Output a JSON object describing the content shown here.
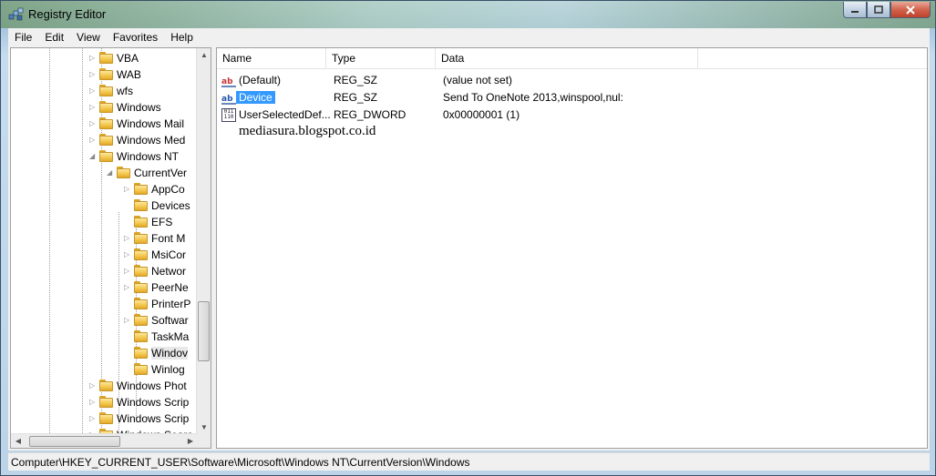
{
  "window": {
    "title": "Registry Editor"
  },
  "menu": [
    "File",
    "Edit",
    "View",
    "Favorites",
    "Help"
  ],
  "tree": {
    "items": [
      {
        "label": "VBA",
        "expander": "collapsed"
      },
      {
        "label": "WAB",
        "expander": "collapsed"
      },
      {
        "label": "wfs",
        "expander": "collapsed"
      },
      {
        "label": "Windows",
        "expander": "collapsed"
      },
      {
        "label": "Windows Mail",
        "expander": "collapsed"
      },
      {
        "label": "Windows Med",
        "expander": "collapsed"
      },
      {
        "label": "Windows NT",
        "expander": "expanded"
      },
      {
        "label": "CurrentVer",
        "expander": "expanded"
      },
      {
        "label": "AppCo",
        "expander": "collapsed"
      },
      {
        "label": "Devices",
        "expander": "none"
      },
      {
        "label": "EFS",
        "expander": "none"
      },
      {
        "label": "Font M",
        "expander": "collapsed"
      },
      {
        "label": "MsiCor",
        "expander": "collapsed"
      },
      {
        "label": "Networ",
        "expander": "collapsed"
      },
      {
        "label": "PeerNe",
        "expander": "collapsed"
      },
      {
        "label": "PrinterP",
        "expander": "none"
      },
      {
        "label": "Softwar",
        "expander": "collapsed"
      },
      {
        "label": "TaskMa",
        "expander": "none"
      },
      {
        "label": "Windov",
        "expander": "none",
        "selected": true
      },
      {
        "label": "Winlog",
        "expander": "none"
      },
      {
        "label": "Windows Phot",
        "expander": "collapsed"
      },
      {
        "label": "Windows Scrip",
        "expander": "collapsed"
      },
      {
        "label": "Windows Scrip",
        "expander": "collapsed"
      },
      {
        "label": "Windows Searc",
        "expander": "collapsed"
      }
    ]
  },
  "list": {
    "columns": [
      "Name",
      "Type",
      "Data"
    ],
    "rows": [
      {
        "name": "(Default)",
        "type": "REG_SZ",
        "data": "(value not set)",
        "icon": "string-value-icon"
      },
      {
        "name": "Device",
        "type": "REG_SZ",
        "data": "Send To OneNote 2013,winspool,nul:",
        "icon": "string-value-icon",
        "selected": true
      },
      {
        "name": "UserSelectedDef...",
        "type": "REG_DWORD",
        "data": "0x00000001 (1)",
        "icon": "binary-value-icon"
      }
    ]
  },
  "watermark": "mediasura.blogspot.co.id",
  "status": "Computer\\HKEY_CURRENT_USER\\Software\\Microsoft\\Windows NT\\CurrentVersion\\Windows"
}
